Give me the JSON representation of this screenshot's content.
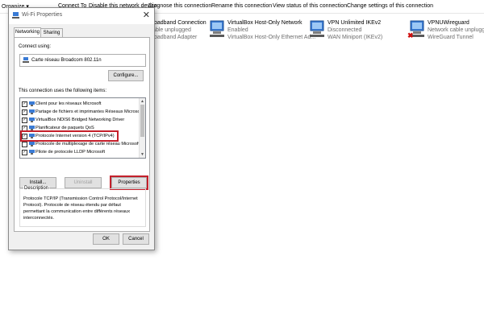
{
  "background": {
    "toolbar": [
      "Organize ▾",
      "Connect To",
      "Disable this network device",
      "Diagnose this connection",
      "Rename this connection",
      "View status of this connection",
      "Change settings of this connection"
    ],
    "connections": [
      {
        "name": "Broadband Connection",
        "status": "Cable unplugged",
        "device": "Broadband Adapter",
        "error": true,
        "icon": "broadband-icon"
      },
      {
        "name": "VirtualBox Host-Only Network",
        "status": "Enabled",
        "device": "VirtualBox Host-Only Ethernet Ad...",
        "error": false,
        "icon": "network-adapter-icon"
      },
      {
        "name": "VPN Unlimited IKEv2",
        "status": "Disconnected",
        "device": "WAN Miniport (IKEv2)",
        "error": false,
        "icon": "vpn-icon"
      },
      {
        "name": "VPNUWireguard",
        "status": "Network cable unplugged",
        "device": "WireGuard Tunnel",
        "error": true,
        "icon": "network-adapter-icon"
      }
    ]
  },
  "dialog": {
    "title": "Wi-Fi Properties",
    "close_glyph": "✕",
    "tabs": [
      "Networking",
      "Sharing"
    ],
    "connect_using_label": "Connect using:",
    "adapter_name": "Carte réseau Broadcom 802.11n",
    "configure_label": "Configure...",
    "items_label": "This connection uses the following items:",
    "items": [
      {
        "label": "Client pour les réseaux Microsoft",
        "checked": true,
        "highlighted": false
      },
      {
        "label": "Partage de fichiers et imprimantes Réseaux Microsoft",
        "checked": true,
        "highlighted": false
      },
      {
        "label": "VirtualBox NDIS6 Bridged Networking Driver",
        "checked": true,
        "highlighted": false
      },
      {
        "label": "Planificateur de paquets QoS",
        "checked": true,
        "highlighted": false
      },
      {
        "label": "Protocole Internet version 4 (TCP/IPv4)",
        "checked": true,
        "highlighted": true
      },
      {
        "label": "Protocole de multiplexage de carte réseau Microsoft",
        "checked": false,
        "highlighted": false
      },
      {
        "label": "Pilote de protocole LLDP Microsoft",
        "checked": true,
        "highlighted": false
      }
    ],
    "install_label": "Install...",
    "uninstall_label": "Uninstall",
    "properties_label": "Properties",
    "description_title": "Description",
    "description_text": "Protocole TCP/IP (Transmission Control Protocol/Internet Protocol). Protocole de réseau étendu par défaut permettant la communication entre différents réseaux interconnectés.",
    "ok_label": "OK",
    "cancel_label": "Cancel"
  },
  "colors": {
    "highlight": "#c4202b",
    "error": "#d10e0e"
  }
}
